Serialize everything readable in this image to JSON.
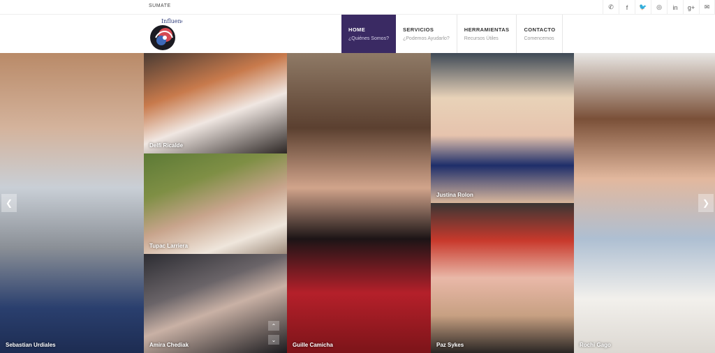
{
  "topbar": {
    "sumate": "SUMATE",
    "social": [
      {
        "icon": "phone-icon",
        "glyph": "✆"
      },
      {
        "icon": "facebook-icon",
        "glyph": "f"
      },
      {
        "icon": "twitter-icon",
        "glyph": "🐦"
      },
      {
        "icon": "instagram-icon",
        "glyph": "◎"
      },
      {
        "icon": "linkedin-icon",
        "glyph": "in"
      },
      {
        "icon": "google-plus-icon",
        "glyph": "g+"
      },
      {
        "icon": "email-icon",
        "glyph": "✉"
      }
    ]
  },
  "logo": {
    "text": "Influencer"
  },
  "nav": [
    {
      "title": "HOME",
      "sub": "¿Quiénes Somos?",
      "active": true
    },
    {
      "title": "SERVICIOS",
      "sub": "¿Podemos Ayudarlo?",
      "active": false
    },
    {
      "title": "HERRAMIENTAS",
      "sub": "Recursos Útiles",
      "active": false
    },
    {
      "title": "CONTACTO",
      "sub": "Comencemos",
      "active": false
    }
  ],
  "influencers": [
    {
      "name": "Sebastian Urdiales"
    },
    {
      "name": "Delfi Ricalde"
    },
    {
      "name": "Tupac Larriera"
    },
    {
      "name": "Amira Chediak"
    },
    {
      "name": "Guille Camicha"
    },
    {
      "name": "Justina Rolon"
    },
    {
      "name": "Paz Sykes"
    },
    {
      "name": "Rochi Gago"
    }
  ],
  "controls": {
    "prev": "❮",
    "next": "❯",
    "up": "⌃",
    "down": "⌄"
  }
}
